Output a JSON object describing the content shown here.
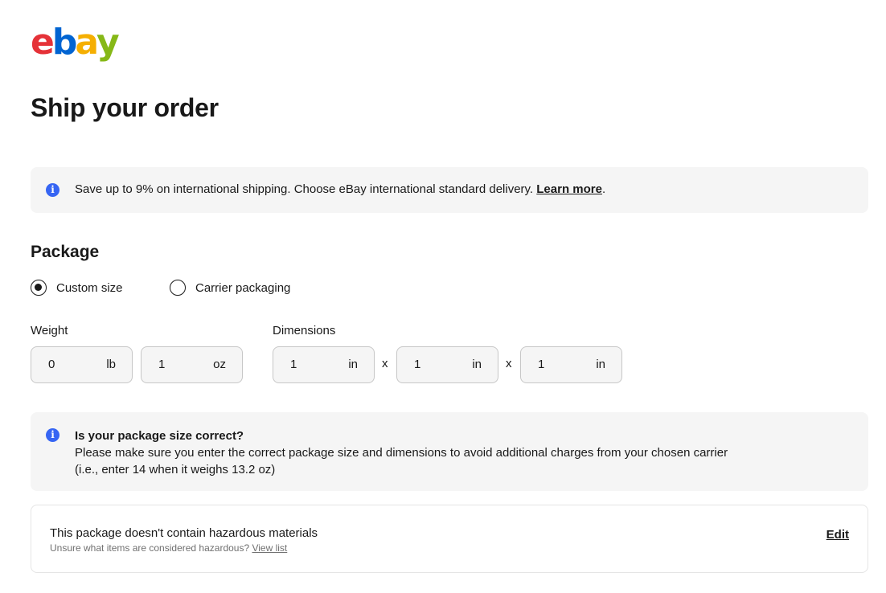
{
  "logo": {
    "letters": [
      "e",
      "b",
      "a",
      "y"
    ],
    "colors": [
      "#e53238",
      "#0064d2",
      "#f5af02",
      "#86b817"
    ]
  },
  "page_title": "Ship your order",
  "promo_banner": {
    "icon": "info-icon",
    "message": "Save up to 9% on international shipping. Choose eBay international standard delivery. ",
    "link_label": "Learn more",
    "suffix": "."
  },
  "package": {
    "title": "Package",
    "options": [
      {
        "label": "Custom size",
        "selected": true
      },
      {
        "label": "Carrier packaging",
        "selected": false
      }
    ],
    "weight": {
      "label": "Weight",
      "fields": [
        {
          "value": "0",
          "unit": "lb"
        },
        {
          "value": "1",
          "unit": "oz"
        }
      ]
    },
    "dimensions": {
      "label": "Dimensions",
      "separator": "x",
      "fields": [
        {
          "value": "1",
          "unit": "in"
        },
        {
          "value": "1",
          "unit": "in"
        },
        {
          "value": "1",
          "unit": "in"
        }
      ]
    }
  },
  "size_notice": {
    "icon": "info-icon",
    "title": "Is your package size correct?",
    "line1": "Please make sure you enter the correct package size and dimensions to avoid additional charges from your chosen carrier",
    "line2": "(i.e., enter 14 when it weighs 13.2 oz)"
  },
  "hazardous": {
    "title": "This package doesn't contain hazardous materials",
    "subtitle": "Unsure what items are considered hazardous? ",
    "view_list_label": "View list",
    "edit_label": "Edit"
  },
  "colors": {
    "accent_blue": "#3665f3",
    "banner_bg": "#f5f5f5"
  }
}
